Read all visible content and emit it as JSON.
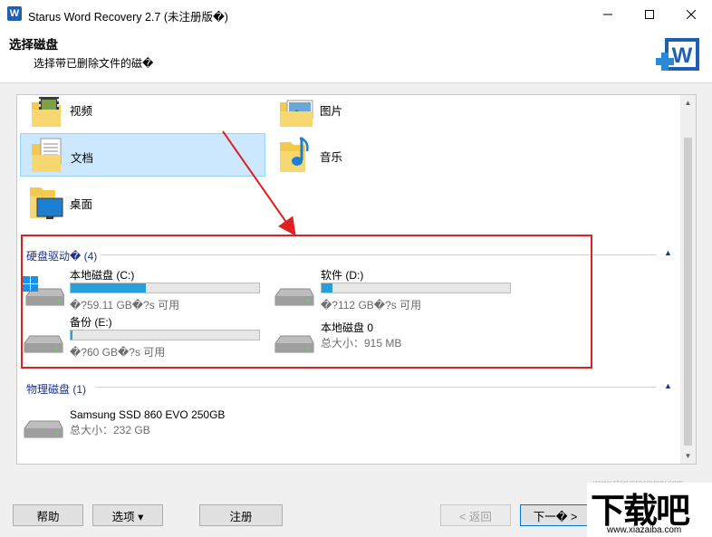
{
  "window": {
    "title": "Starus Word Recovery 2.7 (未注册版�)",
    "minimize": "—",
    "maximize": "☐",
    "close": "✕"
  },
  "header": {
    "title": "选择磁盘",
    "subtitle": "选择带已删除文件的磁�",
    "logo_letter": "W"
  },
  "folders": [
    {
      "label": "视频",
      "icon": "video-folder-icon"
    },
    {
      "label": "图片",
      "icon": "pictures-folder-icon"
    },
    {
      "label": "文档",
      "icon": "documents-folder-icon",
      "selected": true
    },
    {
      "label": "音乐",
      "icon": "music-folder-icon"
    },
    {
      "label": "桌面",
      "icon": "desktop-folder-icon"
    }
  ],
  "hard_drives": {
    "header": "硬盘驱动� (4)",
    "drives": [
      {
        "name": "本地磁盘 (C:)",
        "info": "�?59.11 GB�?s 可用",
        "used_fraction": 0.4,
        "icon": "windows-drive-icon"
      },
      {
        "name": "软件 (D:)",
        "info": "�?112 GB�?s 可用",
        "used_fraction": 0.06,
        "icon": "hard-drive-icon"
      },
      {
        "name": "备份 (E:)",
        "info": "�?60 GB�?s 可用",
        "used_fraction": 0.01,
        "icon": "hard-drive-icon"
      },
      {
        "name": "本地磁盘 0",
        "info": "总大小：915 MB",
        "icon": "hard-drive-icon"
      }
    ]
  },
  "physical_disks": {
    "header": "物理磁盘 (1)",
    "disks": [
      {
        "name": "Samsung SSD 860 EVO 250GB",
        "info": "总大小：232 GB"
      }
    ]
  },
  "buttons": {
    "help": "帮助",
    "options": "选项 ▾",
    "register": "注册",
    "back": "< 返回",
    "next": "下一� >"
  },
  "watermark": {
    "logo": "下载吧",
    "url": "www.xiazaiba.com",
    "faded": "www.starusrecovery.com"
  },
  "colors": {
    "accent": "#26a0da",
    "section": "#1e3287",
    "highlight": "#e02020",
    "selection": "#cce8ff"
  }
}
